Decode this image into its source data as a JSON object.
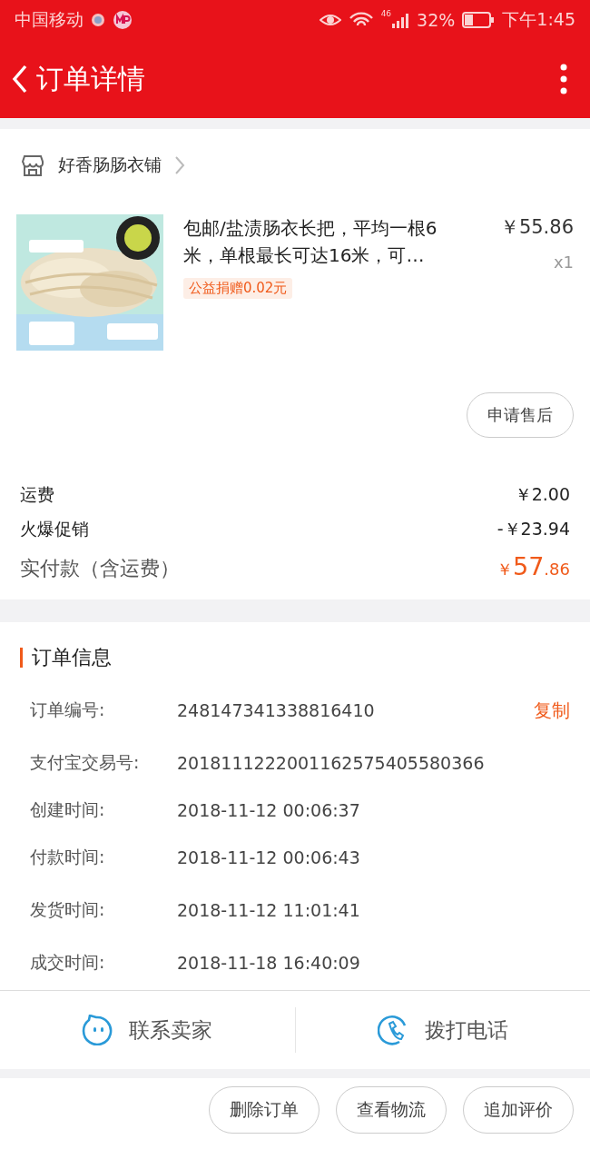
{
  "status_bar": {
    "carrier": "中国移动",
    "network_label": "46",
    "battery_text": "32%",
    "time": "下午1:45"
  },
  "nav": {
    "title": "订单详情"
  },
  "shop": {
    "name": "好香肠肠衣铺"
  },
  "product": {
    "kind": "picture",
    "title": "包邮/盐渍肠衣长把，平均一根6米，单根最长可达16米，可…",
    "price": "￥55.86",
    "quantity": "x1",
    "tag": "公益捐赠0.02元",
    "after_sale": "申请售后"
  },
  "fees": [
    {
      "label": "运费",
      "value": "￥2.00"
    },
    {
      "label": "火爆促销",
      "value": "-￥23.94"
    }
  ],
  "total": {
    "label": "实付款（含运费）",
    "currency": "￥",
    "integer": "57",
    "decimal": ".86"
  },
  "order_info": {
    "title": "订单信息",
    "copy": "复制",
    "rows": [
      {
        "label": "订单编号:",
        "value": "248147341338816410"
      },
      {
        "label": "支付宝交易号:",
        "value": "2018111222001162575405580366"
      },
      {
        "label": "创建时间:",
        "value": "2018-11-12 00:06:37"
      },
      {
        "label": "付款时间:",
        "value": "2018-11-12 00:06:43"
      },
      {
        "label": "发货时间:",
        "value": "2018-11-12 11:01:41"
      },
      {
        "label": "成交时间:",
        "value": "2018-11-18 16:40:09"
      }
    ]
  },
  "contact": [
    {
      "kind": "chat",
      "label": "联系卖家"
    },
    {
      "kind": "phone",
      "label": "拨打电话"
    }
  ],
  "actions": [
    "删除订单",
    "查看物流",
    "追加评价"
  ]
}
